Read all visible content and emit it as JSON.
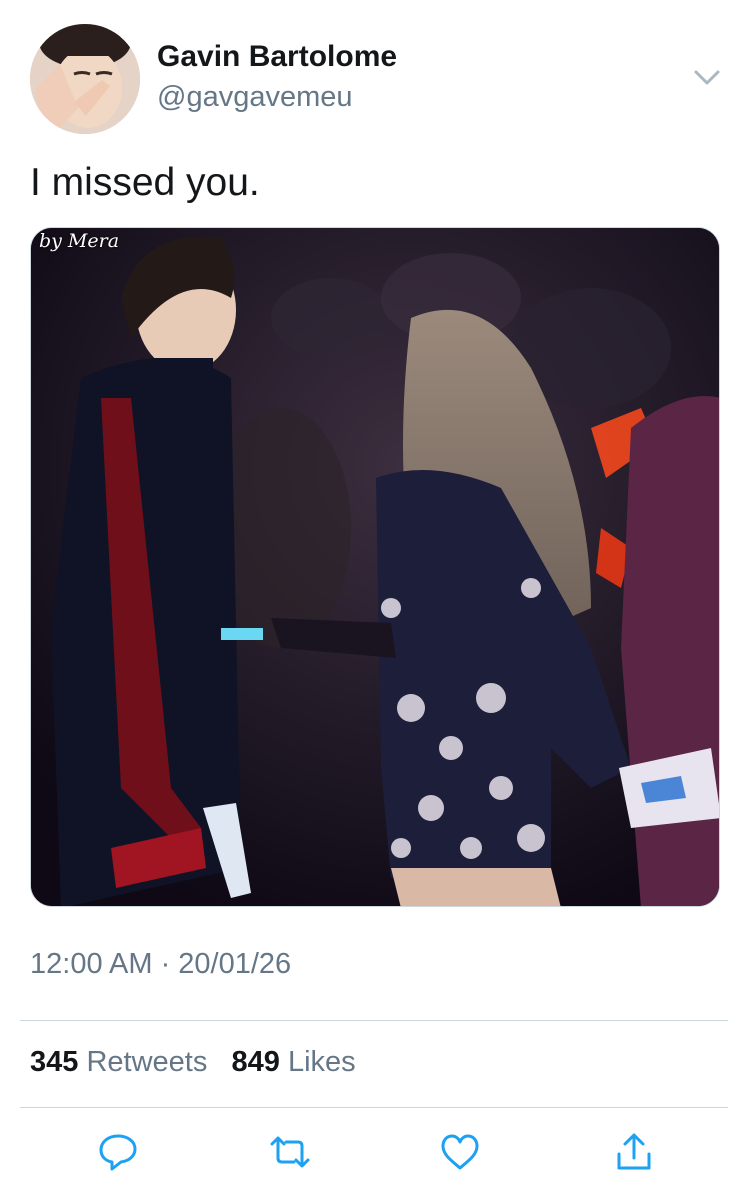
{
  "user": {
    "display_name": "Gavin Bartolome",
    "handle": "@gavgavemeu",
    "avatar_icon": "profile-photo"
  },
  "tweet": {
    "text": "I missed you.",
    "media": {
      "watermark": "by Mera"
    },
    "timestamp": "12:00 AM · 20/01/26"
  },
  "stats": {
    "retweets": {
      "count": "345",
      "label": "Retweets"
    },
    "likes": {
      "count": "849",
      "label": "Likes"
    }
  },
  "actions": [
    {
      "icon": "reply-icon"
    },
    {
      "icon": "retweet-icon"
    },
    {
      "icon": "like-icon"
    },
    {
      "icon": "share-icon"
    }
  ],
  "colors": {
    "text_primary": "#14171a",
    "text_secondary": "#657786",
    "divider": "#ccd6dd",
    "icon": "#1da1f2"
  }
}
